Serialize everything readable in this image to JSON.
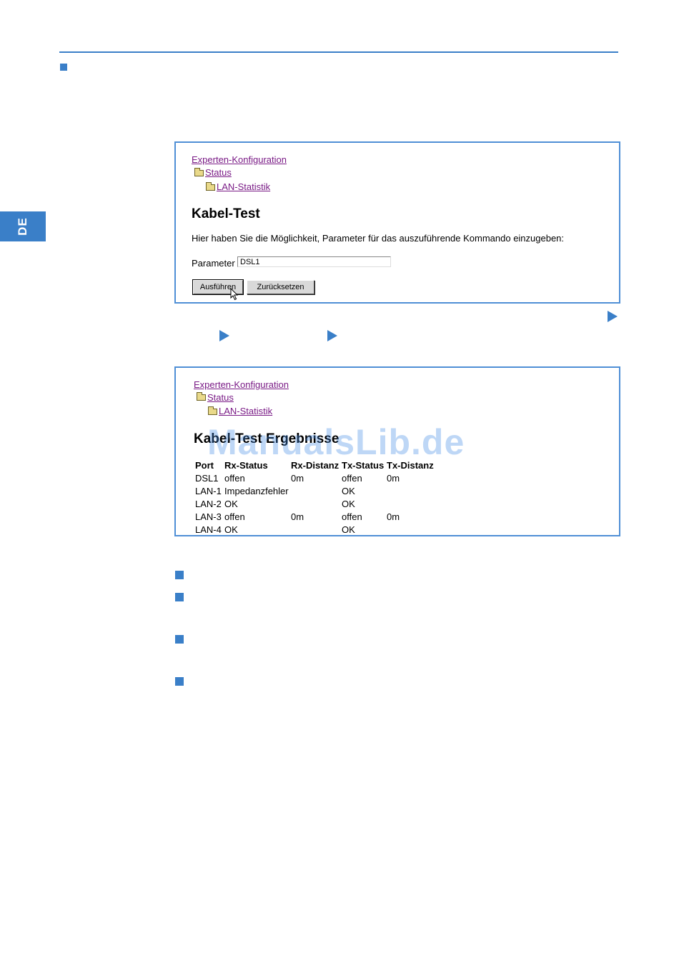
{
  "side_tab": {
    "label": "DE"
  },
  "screenshot1": {
    "breadcrumb": {
      "root": "Experten-Konfiguration",
      "level1": "Status",
      "level2": "LAN-Statistik"
    },
    "title": "Kabel-Test",
    "description": "Hier haben Sie die Möglichkeit, Parameter für das auszuführende Kommando einzugeben:",
    "parameter_label": "Parameter",
    "parameter_value": "DSL1",
    "execute_button": "Ausführen",
    "reset_button": "Zurücksetzen"
  },
  "screenshot2": {
    "breadcrumb": {
      "root": "Experten-Konfiguration",
      "level1": "Status",
      "level2": "LAN-Statistik"
    },
    "title": "Kabel-Test Ergebnisse",
    "columns": [
      "Port",
      "Rx-Status",
      "Rx-Distanz",
      "Tx-Status",
      "Tx-Distanz"
    ],
    "rows": [
      [
        "DSL1",
        "offen",
        "0m",
        "offen",
        "0m"
      ],
      [
        "LAN-1",
        "Impedanzfehler",
        "",
        "OK",
        ""
      ],
      [
        "LAN-2",
        "OK",
        "",
        "OK",
        ""
      ],
      [
        "LAN-3",
        "offen",
        "0m",
        "offen",
        "0m"
      ],
      [
        "LAN-4",
        "OK",
        "",
        "OK",
        ""
      ]
    ]
  },
  "watermark": "ManualsLib.de",
  "colors": {
    "accent": "#3a7fc8",
    "link": "#7a1b86"
  },
  "icons": [
    "folder-icon",
    "mouse-pointer-icon",
    "arrow-right-icon",
    "bullet-square-icon"
  ]
}
